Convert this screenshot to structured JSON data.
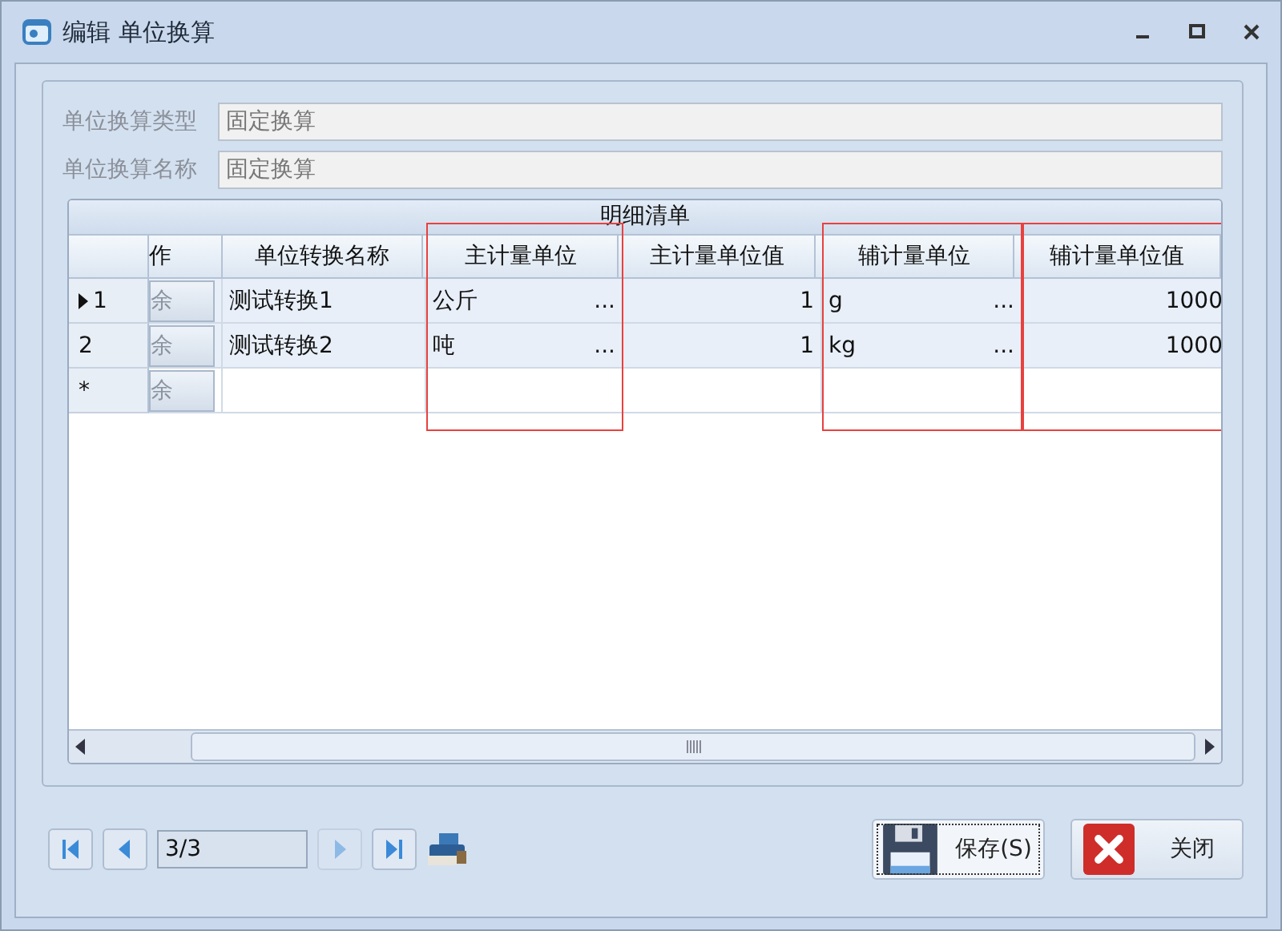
{
  "window": {
    "title": "编辑 单位换算"
  },
  "fields": [
    {
      "label": "单位换算类型",
      "value": "固定换算",
      "disabled": true
    },
    {
      "label": "单位换算名称",
      "value": "固定换算",
      "disabled": true
    }
  ],
  "grid": {
    "title": "明细清单",
    "columns": [
      {
        "label": "作",
        "kind": "button",
        "highlighted": false
      },
      {
        "label": "单位转换名称",
        "kind": "text",
        "highlighted": false
      },
      {
        "label": "主计量单位",
        "kind": "lookup",
        "highlighted": true
      },
      {
        "label": "主计量单位值",
        "kind": "number",
        "highlighted": false
      },
      {
        "label": "辅计量单位",
        "kind": "lookup",
        "highlighted": true
      },
      {
        "label": "辅计量单位值",
        "kind": "number",
        "highlighted": true
      }
    ],
    "rows": [
      {
        "indicator": "1",
        "current": true,
        "new": false,
        "cells": [
          {
            "text": "余"
          },
          {
            "text": "测试转换1"
          },
          {
            "text": "公斤",
            "button": "..."
          },
          {
            "text": "1"
          },
          {
            "text": "g",
            "button": "..."
          },
          {
            "text": "1000"
          }
        ]
      },
      {
        "indicator": "2",
        "current": false,
        "new": false,
        "cells": [
          {
            "text": "余"
          },
          {
            "text": "测试转换2"
          },
          {
            "text": "吨",
            "button": "..."
          },
          {
            "text": "1"
          },
          {
            "text": "kg",
            "button": "..."
          },
          {
            "text": "1000"
          }
        ]
      },
      {
        "indicator": "*",
        "current": false,
        "new": true,
        "cells": [
          {
            "text": "余"
          }
        ]
      }
    ]
  },
  "navigator": {
    "position": "3/3",
    "first_disabled": false,
    "prev_disabled": false,
    "next_disabled": true,
    "last_disabled": false
  },
  "buttons": [
    {
      "label": "保存(S)",
      "kind": "save",
      "focused": true
    },
    {
      "label": "关闭",
      "kind": "close",
      "focused": false
    }
  ]
}
